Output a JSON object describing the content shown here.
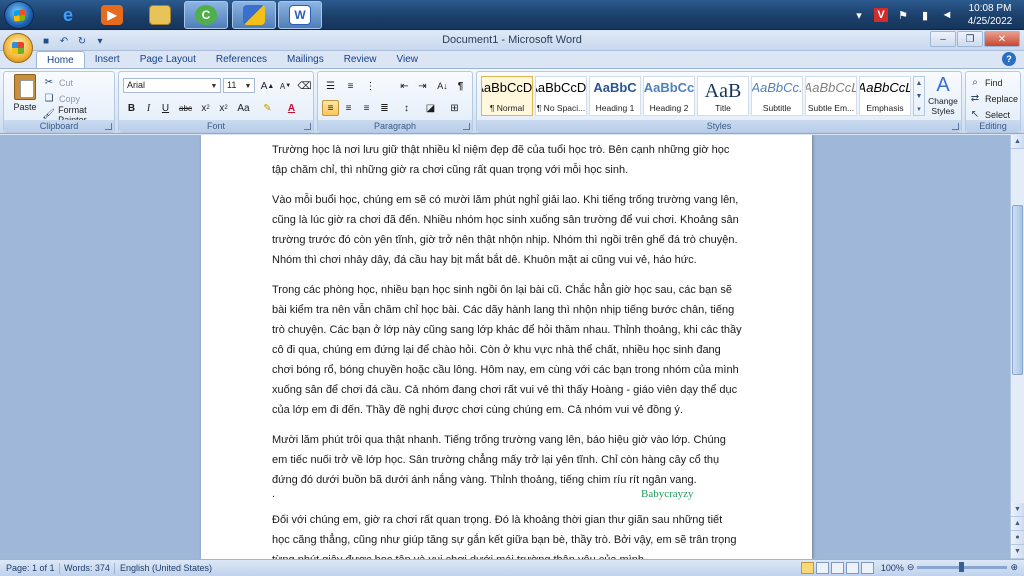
{
  "taskbar": {
    "clock": {
      "time": "10:08 PM",
      "date": "4/25/2022"
    },
    "apps": [
      "windows-media-player",
      "ie",
      "media-player",
      "explorer",
      "app-green",
      "security",
      "word"
    ]
  },
  "window": {
    "title": "Document1 - Microsoft Word"
  },
  "ribbon": {
    "tabs": [
      "Home",
      "Insert",
      "Page Layout",
      "References",
      "Mailings",
      "Review",
      "View"
    ],
    "clipboard": {
      "paste": "Paste",
      "cut": "Cut",
      "copy": "Copy",
      "format_painter": "Format Painter",
      "label": "Clipboard"
    },
    "font": {
      "name": "Arial",
      "size": "11",
      "label": "Font"
    },
    "paragraph": {
      "label": "Paragraph"
    },
    "styles": {
      "label": "Styles",
      "items": [
        {
          "preview": "AaBbCcDc",
          "name": "¶ Normal"
        },
        {
          "preview": "AaBbCcDc",
          "name": "¶ No Spaci..."
        },
        {
          "preview": "AaBbC",
          "name": "Heading 1"
        },
        {
          "preview": "AaBbCc",
          "name": "Heading 2"
        },
        {
          "preview": "AaB",
          "name": "Title"
        },
        {
          "preview": "AaBbCc.",
          "name": "Subtitle"
        },
        {
          "preview": "AaBbCcL",
          "name": "Subtle Em..."
        },
        {
          "preview": "AaBbCcL",
          "name": "Emphasis"
        }
      ],
      "change_styles": "Change Styles"
    },
    "editing": {
      "find": "Find",
      "replace": "Replace",
      "select": "Select",
      "label": "Editing"
    }
  },
  "document": {
    "paragraphs": [
      "Trường học là nơi lưu giữ thật nhiều kỉ niệm đẹp đẽ của tuổi học trò. Bên cạnh những giờ học tập chăm chỉ, thì những giờ ra chơi cũng rất quan trọng với mỗi học sinh.",
      "Vào mỗi buổi học, chúng em sẽ có mười lăm phút nghỉ giải lao. Khi tiếng trống trường vang lên, cũng là lúc giờ ra chơi đã đến. Nhiều nhóm học sinh xuống sân trường để vui chơi. Khoảng sân trường trước đó còn yên tĩnh, giờ trở nên thật nhộn nhịp. Nhóm thì ngồi trên ghế đá trò chuyện. Nhóm thì chơi nhảy dây, đá cầu hay bịt mắt bắt dê. Khuôn mặt ai cũng vui vẻ, háo hức.",
      "Trong các phòng học, nhiều bạn học sinh ngồi ôn lại bài cũ. Chắc hẳn giờ học sau, các bạn sẽ bài kiểm tra nên vẫn chăm chỉ học bài. Các dãy hành lang thì nhộn nhịp tiếng bước chân, tiếng trò chuyện. Các bạn ở lớp này cũng sang lớp khác để hỏi thăm nhau. Thỉnh thoảng, khi các thầy cô đi qua, chúng em đứng lại để chào hỏi. Còn ở khu vực nhà thể chất, nhiều học sinh đang chơi bóng rổ, bóng chuyền hoặc cầu lông. Hôm nay, em cùng với các bạn trong nhóm của mình xuống sân để chơi đá cầu. Cả nhóm đang chơi rất vui vẻ thì thấy Hoàng - giáo viên dạy thể dục của lớp em đi đến. Thầy đề nghị được chơi cùng chúng em. Cả nhóm vui vẻ đồng ý.",
      "Mười lăm phút trôi qua thật nhanh. Tiếng trống trường vang lên, báo hiệu giờ vào lớp. Chúng em tiếc nuối trở về lớp học. Sân trường chẳng mấy trở lại yên tĩnh. Chỉ còn hàng cây cổ thụ đứng đó dưới buồn bã dưới ánh nắng vàng. Thỉnh thoảng, tiếng chim ríu rít ngân vang.",
      "Đối với chúng em, giờ ra chơi rất quan trọng. Đó là khoảng thời gian thư giãn sau những tiết học căng thẳng, cũng như giúp tăng sự gắn kết giữa bạn bè, thầy trò. Bởi vậy, em sẽ trân trọng từng phút giây được học tập và vui chơi dưới mái trường thân yêu của mình."
    ],
    "dot": ".",
    "watermark": "Babycrayzy"
  },
  "status": {
    "page": "Page: 1 of 1",
    "words": "Words: 374",
    "language": "English (United States)",
    "zoom": "100%"
  }
}
